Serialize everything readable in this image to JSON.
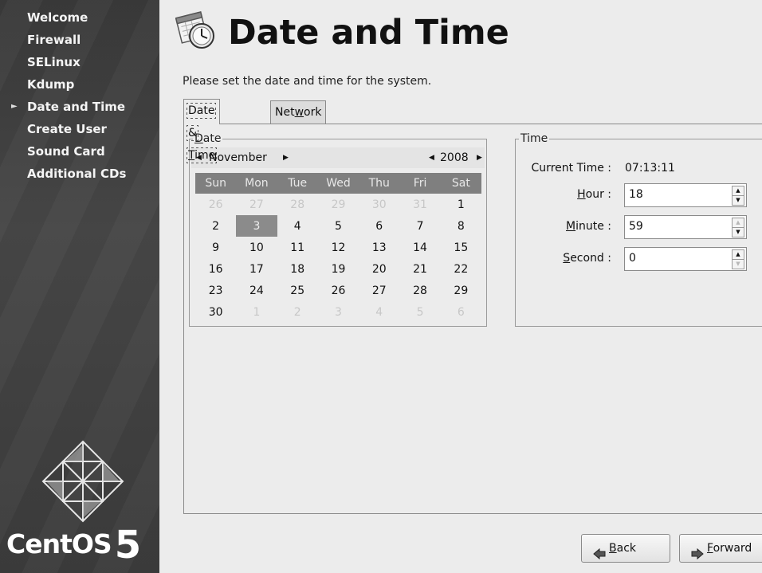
{
  "sidebar": {
    "items": [
      {
        "label": "Welcome"
      },
      {
        "label": "Firewall"
      },
      {
        "label": "SELinux"
      },
      {
        "label": "Kdump"
      },
      {
        "label": "Date and Time",
        "current": true
      },
      {
        "label": "Create User"
      },
      {
        "label": "Sound Card"
      },
      {
        "label": "Additional CDs"
      }
    ],
    "brand_name": "CentOS",
    "brand_version": "5"
  },
  "header": {
    "title": "Date and Time",
    "subtitle": "Please set the date and time for the system.",
    "icon": "clock-calendar-icon"
  },
  "tabs": [
    {
      "pre": "Date & ",
      "mnemonic": "T",
      "post": "ime",
      "active": true
    },
    {
      "pre": "Net",
      "mnemonic": "w",
      "post": "ork Time Protocol",
      "active": false
    }
  ],
  "date_group": {
    "legend_mnemonic": "D",
    "legend_rest": "ate",
    "month": "November",
    "year": "2008",
    "weekdays": [
      "Sun",
      "Mon",
      "Tue",
      "Wed",
      "Thu",
      "Fri",
      "Sat"
    ],
    "weeks": [
      [
        "26",
        "27",
        "28",
        "29",
        "30",
        "31",
        "1"
      ],
      [
        "2",
        "3",
        "4",
        "5",
        "6",
        "7",
        "8"
      ],
      [
        "9",
        "10",
        "11",
        "12",
        "13",
        "14",
        "15"
      ],
      [
        "16",
        "17",
        "18",
        "19",
        "20",
        "21",
        "22"
      ],
      [
        "23",
        "24",
        "25",
        "26",
        "27",
        "28",
        "29"
      ],
      [
        "30",
        "1",
        "2",
        "3",
        "4",
        "5",
        "6"
      ]
    ],
    "selected_day": "3"
  },
  "time_group": {
    "legend": "Time",
    "current_time_label": "Current Time :",
    "current_time": "07:13:11",
    "hour": {
      "mnemonic": "H",
      "rest": "our :",
      "value": "18"
    },
    "minute": {
      "mnemonic": "M",
      "rest": "inute :",
      "value": "59"
    },
    "second": {
      "mnemonic": "S",
      "rest": "econd :",
      "value": "0"
    }
  },
  "buttons": {
    "back": {
      "mnemonic": "B",
      "rest": "ack"
    },
    "forward": {
      "mnemonic": "F",
      "rest": "orward"
    }
  },
  "colors": {
    "sidebar_bg": "#3f3f3f",
    "calendar_header_bg": "#7f7f7f",
    "selected_day_bg": "#8b8b8b"
  }
}
